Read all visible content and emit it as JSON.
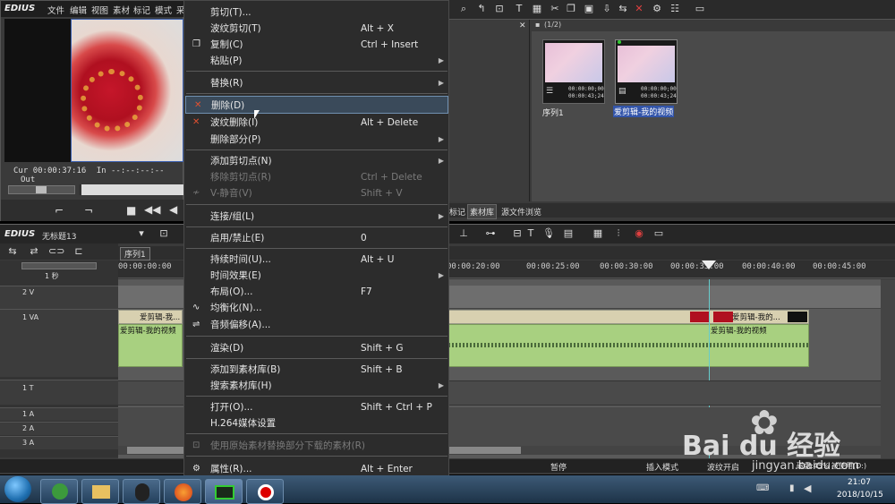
{
  "app": {
    "name": "EDIUS",
    "menu": [
      "文件",
      "编辑",
      "视图",
      "素材",
      "标记",
      "模式",
      "采"
    ]
  },
  "player": {
    "cur_label": "Cur",
    "cur_value": "00:00:37:16",
    "in_label": "In",
    "in_value": "--:--:--:--",
    "out_label": "Out"
  },
  "bin": {
    "folder_label": "(1/2)",
    "clips": [
      {
        "name": "序列1",
        "tc1": "00:00:00;00",
        "tc2": "00:00:43;24"
      },
      {
        "name": "爱剪辑-我的视频",
        "tc1": "00:00:00;00",
        "tc2": "00:00:43;24"
      }
    ],
    "tabs": [
      "标记",
      "素材库",
      "源文件浏览"
    ]
  },
  "timeline": {
    "app": "EDIUS",
    "project": "无标题13",
    "sequence_tab": "序列1",
    "zoom": "1 秒",
    "ticks": [
      "00:00:00:00",
      "00:00:20:00",
      "00:00:25:00",
      "00:00:30:00",
      "00:00:35:00",
      "00:00:40:00",
      "00:00:45:00"
    ],
    "tracks": [
      {
        "name": "2 V"
      },
      {
        "name": "1 VA"
      },
      {
        "name": "1 T"
      },
      {
        "name": "1 A"
      },
      {
        "name": "2 A"
      },
      {
        "name": "3 A"
      }
    ],
    "clip_label": "爱剪辑-我...",
    "clip_audio_label": "爱剪辑-我的视频",
    "clip_label2": "爱剪辑-我的..."
  },
  "status": {
    "pause": "暂停",
    "insert_mode": "插入模式",
    "ripple": "波纹开启",
    "disk": "磁盘:45% 被使用(D:)"
  },
  "context_menu": {
    "items": [
      {
        "label": "剪切(T)...",
        "shortcut": "",
        "arrow": false,
        "disabled": false
      },
      {
        "label": "波纹剪切(T)",
        "shortcut": "Alt + X",
        "arrow": false,
        "disabled": false
      },
      {
        "label": "复制(C)",
        "shortcut": "Ctrl + Insert",
        "arrow": false,
        "disabled": false
      },
      {
        "label": "粘贴(P)",
        "shortcut": "",
        "arrow": true,
        "disabled": false
      },
      {
        "label": "替换(R)",
        "shortcut": "",
        "arrow": true,
        "disabled": false
      },
      {
        "label": "删除(D)",
        "shortcut": "",
        "arrow": false,
        "disabled": false
      },
      {
        "label": "波纹删除(I)",
        "shortcut": "Alt + Delete",
        "arrow": false,
        "disabled": false
      },
      {
        "label": "删除部分(P)",
        "shortcut": "",
        "arrow": true,
        "disabled": false
      },
      {
        "label": "添加剪切点(N)",
        "shortcut": "",
        "arrow": true,
        "disabled": false
      },
      {
        "label": "移除剪切点(R)",
        "shortcut": "Ctrl + Delete",
        "arrow": false,
        "disabled": true
      },
      {
        "label": "V-静音(V)",
        "shortcut": "Shift + V",
        "arrow": false,
        "disabled": true
      },
      {
        "label": "连接/组(L)",
        "shortcut": "",
        "arrow": true,
        "disabled": false
      },
      {
        "label": "启用/禁止(E)",
        "shortcut": "0",
        "arrow": false,
        "disabled": false
      },
      {
        "label": "持续时间(U)...",
        "shortcut": "Alt + U",
        "arrow": false,
        "disabled": false
      },
      {
        "label": "时间效果(E)",
        "shortcut": "",
        "arrow": true,
        "disabled": false
      },
      {
        "label": "布局(O)...",
        "shortcut": "F7",
        "arrow": false,
        "disabled": false
      },
      {
        "label": "均衡化(N)...",
        "shortcut": "",
        "arrow": false,
        "disabled": false
      },
      {
        "label": "音频偏移(A)...",
        "shortcut": "",
        "arrow": false,
        "disabled": false
      },
      {
        "label": "渲染(D)",
        "shortcut": "Shift + G",
        "arrow": false,
        "disabled": false
      },
      {
        "label": "添加到素材库(B)",
        "shortcut": "Shift + B",
        "arrow": false,
        "disabled": false
      },
      {
        "label": "搜索素材库(H)",
        "shortcut": "",
        "arrow": true,
        "disabled": false
      },
      {
        "label": "打开(O)...",
        "shortcut": "Shift + Ctrl + P",
        "arrow": false,
        "disabled": false
      },
      {
        "label": "H.264媒体设置",
        "shortcut": "",
        "arrow": false,
        "disabled": false
      },
      {
        "label": "使用原始素材替换部分下载的素材(R)",
        "shortcut": "",
        "arrow": false,
        "disabled": true
      },
      {
        "label": "属性(R)...",
        "shortcut": "Alt + Enter",
        "arrow": false,
        "disabled": false
      }
    ]
  },
  "taskbar": {
    "time": "21:07",
    "date": "2018/10/15"
  },
  "watermark": {
    "logo": "Bai du 经验",
    "url": "jingyan.baidu.com"
  }
}
